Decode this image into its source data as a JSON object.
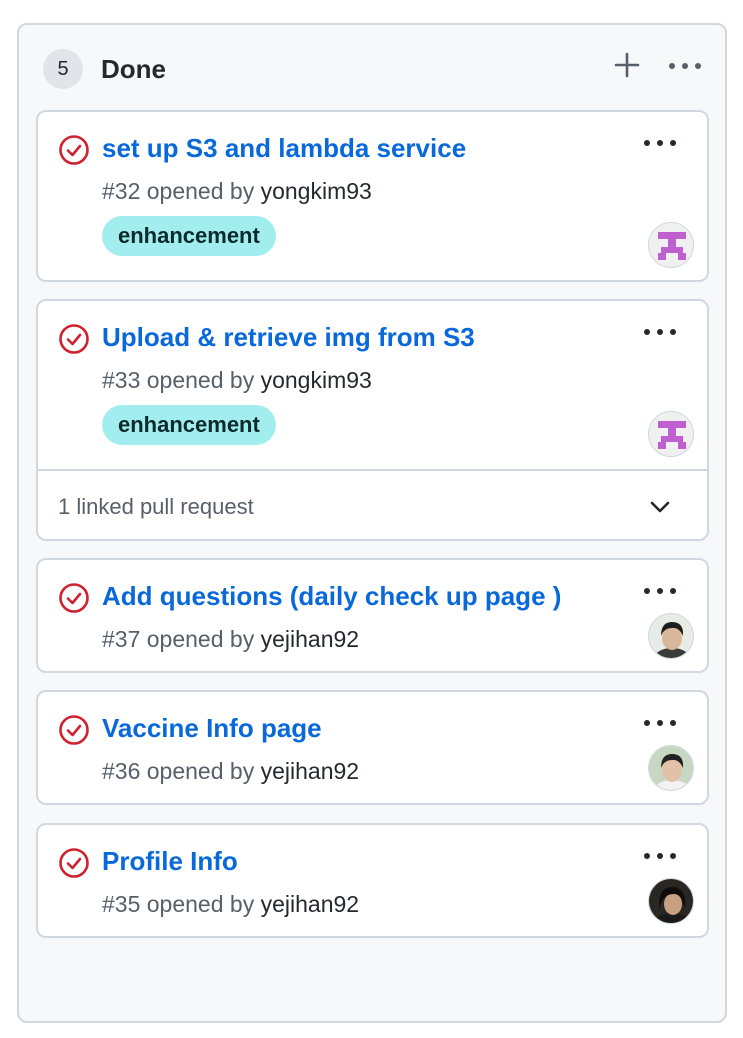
{
  "column": {
    "count": "5",
    "title": "Done"
  },
  "cards": [
    {
      "title": "set up S3 and lambda service",
      "number": "#32",
      "opened_by_text": "opened by",
      "user": "yongkim93",
      "label": "enhancement",
      "avatar": "identicon-avatar"
    },
    {
      "title": "Upload & retrieve img from S3",
      "number": "#33",
      "opened_by_text": "opened by",
      "user": "yongkim93",
      "label": "enhancement",
      "avatar": "identicon-avatar",
      "linked": "1 linked pull request"
    },
    {
      "title": "Add questions (daily check up page )",
      "number": "#37",
      "opened_by_text": "opened by",
      "user": "yejihan92",
      "avatar": "photo-avatar"
    },
    {
      "title": "Vaccine Info page",
      "number": "#36",
      "opened_by_text": "opened by",
      "user": "yejihan92",
      "avatar": "photo-avatar"
    },
    {
      "title": "Profile Info",
      "number": "#35",
      "opened_by_text": "opened by",
      "user": "yejihan92",
      "avatar": "photo-avatar"
    }
  ],
  "colors": {
    "link": "#0969da",
    "closed_icon": "#cf222e",
    "label_bg": "#a2eeef",
    "identicon": "#c05fd0"
  },
  "icons": {
    "add": "plus-icon",
    "more": "kebab-horizontal-icon",
    "issue_state": "issue-closed-icon",
    "expand": "chevron-down-icon"
  }
}
